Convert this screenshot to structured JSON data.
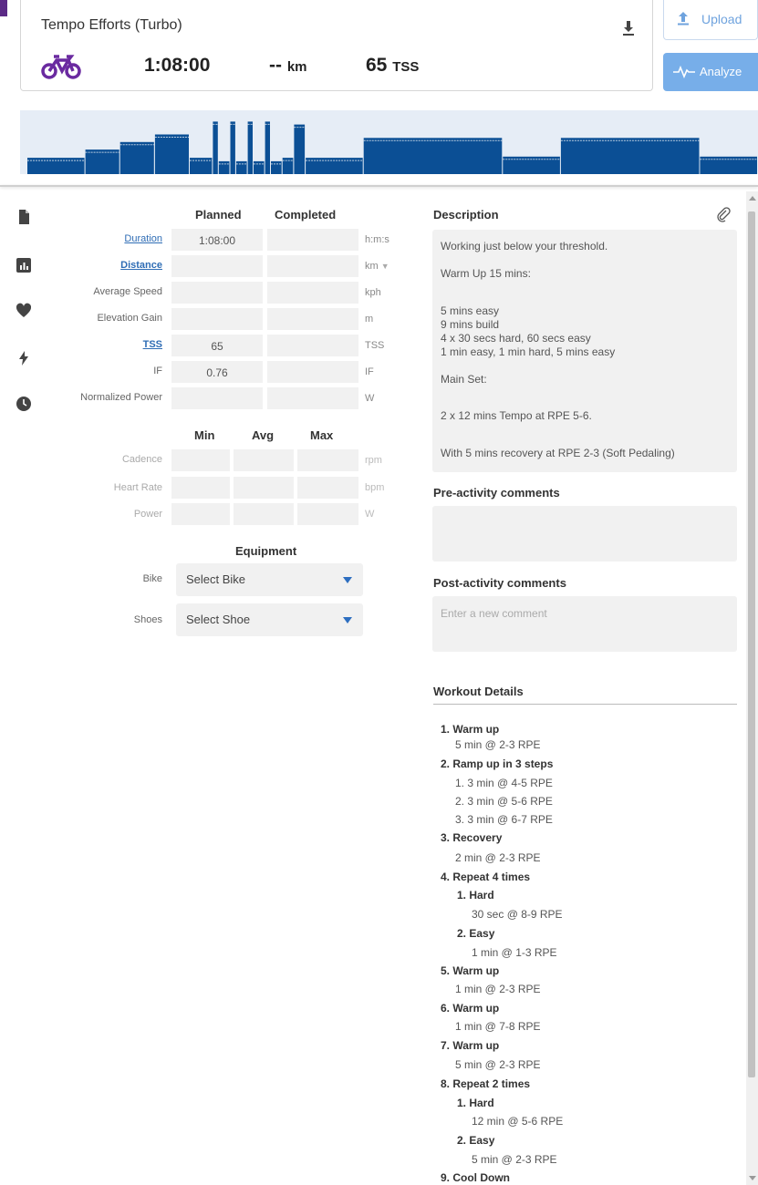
{
  "header": {
    "title": "Tempo Efforts (Turbo)",
    "icon_sport": "bike-icon",
    "duration": "1:08:00",
    "distance_value": "--",
    "distance_unit": "km",
    "tss_value": "65",
    "tss_unit": "TSS",
    "upload_label": "Upload",
    "analyze_label": "Analyze"
  },
  "colors": {
    "accent_purple": "#6a2aa0",
    "profile_blue": "#0b4f95",
    "link_blue": "#2f6db5",
    "analyze_blue": "#77aee9"
  },
  "sidebar": {
    "icons": [
      "document-icon",
      "chart-icon",
      "heart-icon",
      "lightning-icon",
      "clock-icon"
    ]
  },
  "summary": {
    "col_planned": "Planned",
    "col_completed": "Completed",
    "rows": [
      {
        "label": "Duration",
        "planned": "1:08:00",
        "completed": "",
        "unit": "h:m:s"
      },
      {
        "label": "Distance",
        "planned": "",
        "completed": "",
        "unit": "km"
      },
      {
        "label": "Average Speed",
        "planned": "",
        "completed": "",
        "unit": "kph"
      },
      {
        "label": "Elevation Gain",
        "planned": "",
        "completed": "",
        "unit": "m"
      },
      {
        "label": "TSS",
        "planned": "65",
        "completed": "",
        "unit": "TSS"
      },
      {
        "label": "IF",
        "planned": "0.76",
        "completed": "",
        "unit": "IF"
      },
      {
        "label": "Normalized Power",
        "planned": "",
        "completed": "",
        "unit": "W"
      }
    ]
  },
  "minmax": {
    "col_min": "Min",
    "col_avg": "Avg",
    "col_max": "Max",
    "rows": [
      {
        "label": "Cadence",
        "unit": "rpm"
      },
      {
        "label": "Heart Rate",
        "unit": "bpm"
      },
      {
        "label": "Power",
        "unit": "W"
      }
    ]
  },
  "equipment": {
    "title": "Equipment",
    "bike_label": "Bike",
    "bike_value": "Select Bike",
    "shoes_label": "Shoes",
    "shoes_value": "Select Shoe"
  },
  "description": {
    "title": "Description",
    "lines": [
      "Working just below your threshold.",
      "Warm Up 15 mins:",
      "5 mins easy",
      "9 mins build",
      "4 x 30 secs hard, 60 secs easy",
      "1 min easy, 1 min hard, 5 mins easy",
      "Main Set:",
      "2 x 12 mins Tempo at RPE 5-6.",
      "With 5 mins recovery at RPE 2-3 (Soft Pedaling)"
    ]
  },
  "comments": {
    "pre_title": "Pre-activity comments",
    "post_title": "Post-activity comments",
    "post_placeholder": "Enter a new comment"
  },
  "workout_details": {
    "title": "Workout Details",
    "lines": [
      "1. Warm up",
      "5 min @ 2-3 RPE",
      "2. Ramp up in 3 steps",
      "1. 3 min @ 4-5 RPE",
      "2. 3 min @ 5-6 RPE",
      "3. 3 min @ 6-7 RPE",
      "3. Recovery",
      "2 min @ 2-3 RPE",
      "4. Repeat 4 times",
      "1. Hard",
      "30 sec @ 8-9 RPE",
      "2. Easy",
      "1 min @ 1-3 RPE",
      "5. Warm up",
      "1 min @ 2-3 RPE",
      "6. Warm up",
      "1 min @ 7-8 RPE",
      "7. Warm up",
      "5 min @ 2-3 RPE",
      "8. Repeat 2 times",
      "1. Hard",
      "12 min @ 5-6 RPE",
      "2. Easy",
      "5 min @ 2-3 RPE",
      "9. Cool Down"
    ]
  },
  "profile_segments": [
    {
      "min": 5,
      "level": 0.28
    },
    {
      "min": 3,
      "level": 0.42
    },
    {
      "min": 3,
      "level": 0.55
    },
    {
      "min": 3,
      "level": 0.68
    },
    {
      "min": 2,
      "level": 0.28
    },
    {
      "min": 0.5,
      "level": 0.9
    },
    {
      "min": 1,
      "level": 0.22
    },
    {
      "min": 0.5,
      "level": 0.9
    },
    {
      "min": 1,
      "level": 0.22
    },
    {
      "min": 0.5,
      "level": 0.9
    },
    {
      "min": 1,
      "level": 0.22
    },
    {
      "min": 0.5,
      "level": 0.9
    },
    {
      "min": 1,
      "level": 0.22
    },
    {
      "min": 1,
      "level": 0.28
    },
    {
      "min": 1,
      "level": 0.85
    },
    {
      "min": 5,
      "level": 0.28
    },
    {
      "min": 12,
      "level": 0.62
    },
    {
      "min": 5,
      "level": 0.3
    },
    {
      "min": 12,
      "level": 0.62
    },
    {
      "min": 5,
      "level": 0.3
    }
  ]
}
